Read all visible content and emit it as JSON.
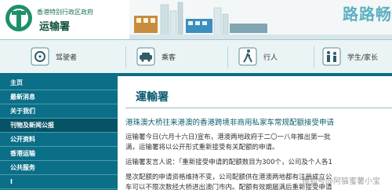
{
  "header": {
    "government_name": "香港特别行政区政府",
    "department_name": "运输署",
    "slogan": "路路畅"
  },
  "user_nav": {
    "items": [
      {
        "label": "驾驶者",
        "icon": "car-steering-icon"
      },
      {
        "label": "乘客",
        "icon": "taxi-icon"
      },
      {
        "label": "行人",
        "icon": "pedestrian-icon"
      },
      {
        "label": "学生/家长",
        "icon": "students-icon"
      }
    ]
  },
  "sidebar": {
    "items": [
      {
        "label": "主页"
      },
      {
        "label": "最新消息"
      },
      {
        "label": "关于我们"
      },
      {
        "label": "刊物及新闻公报"
      },
      {
        "label": "公开资料"
      },
      {
        "label": "香港运输"
      },
      {
        "label": "公共服务"
      },
      {
        "label": "Ⅰ"
      }
    ],
    "active_index": 3
  },
  "main": {
    "title": "運輸署",
    "headline": "港珠澳大桥往来港澳的香港跨境非商用私家车常规配额接受申请",
    "paragraphs": [
      "运输署今日(六月十六日)宣布，港澳两地政府于二〇一八年推出第一批",
      "满，运输署将以公开形式重新接受有关配额的申请。",
      "运输署发言人说：「重新接受申请的配额数目为300个，公司及个人各1",
      "是次配额的申请资格维持不变，公司配额供在港澳两地都有注册成立公",
      "车可以不限次数经大桥进出澳门市内。配额有效期届满后重新接受申请"
    ]
  },
  "watermark": "搜狐号@阿猫蜜薯小宝",
  "colors": {
    "teal_dark": "#0b6f87",
    "teal_active": "#075366",
    "title_teal": "#0b5c6e",
    "logo_green": "#1f6f55"
  }
}
